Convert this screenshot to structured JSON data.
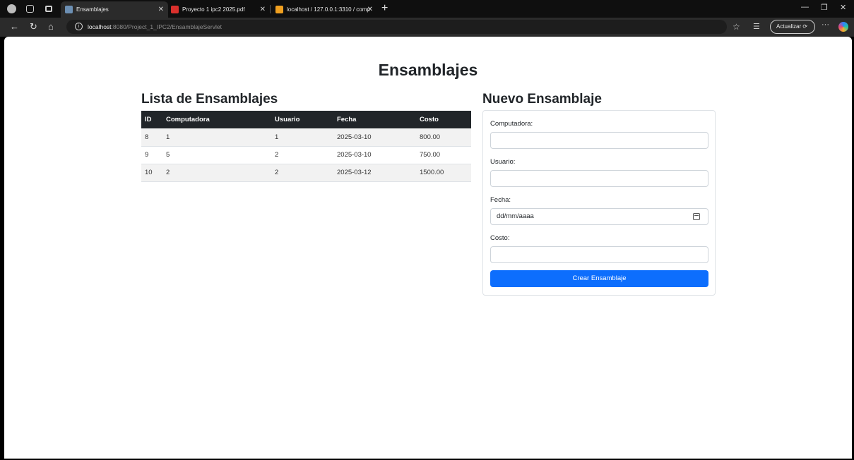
{
  "browser": {
    "tabs": [
      {
        "label": "Ensamblajes",
        "active": true,
        "favicon_color": "#6c8fb3"
      },
      {
        "label": "Proyecto 1 ipc2 2025.pdf",
        "active": false,
        "favicon_color": "#d9302c"
      },
      {
        "label": "localhost / 127.0.0.1:3310 / comp",
        "active": false,
        "favicon_color": "#f0a020"
      }
    ],
    "url_host": "localhost",
    "url_rest": ":8080/Project_1_IPC2/EnsamblajeServlet",
    "update_label": "Actualizar",
    "icons": [
      "profile-avatar",
      "workspaces-icon",
      "tab-actions-icon",
      "back-icon",
      "refresh-icon",
      "home-icon",
      "info-icon",
      "star-icon",
      "favorites-icon",
      "more-icon",
      "copilot-icon",
      "minimize-icon",
      "restore-icon",
      "close-icon"
    ]
  },
  "page": {
    "title": "Ensamblajes",
    "list_title": "Lista de Ensamblajes",
    "form_title": "Nuevo Ensamblaje"
  },
  "table": {
    "headers": [
      "ID",
      "Computadora",
      "Usuario",
      "Fecha",
      "Costo"
    ],
    "rows": [
      [
        "8",
        "1",
        "1",
        "2025-03-10",
        "800.00"
      ],
      [
        "9",
        "5",
        "2",
        "2025-03-10",
        "750.00"
      ],
      [
        "10",
        "2",
        "2",
        "2025-03-12",
        "1500.00"
      ]
    ]
  },
  "form": {
    "computadora_label": "Computadora:",
    "usuario_label": "Usuario:",
    "fecha_label": "Fecha:",
    "fecha_placeholder": "dd/mm/aaaa",
    "costo_label": "Costo:",
    "submit_label": "Crear Ensamblaje"
  },
  "colors": {
    "primary": "#0d6efd",
    "table_header": "#212529"
  }
}
